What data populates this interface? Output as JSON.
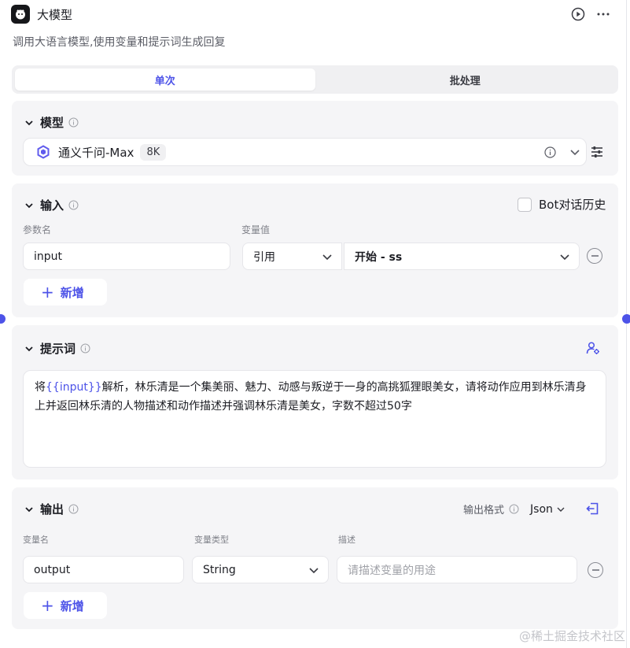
{
  "node": {
    "title": "大模型",
    "description": "调用大语言模型,使用变量和提示词生成回复"
  },
  "tabs": [
    {
      "label": "单次",
      "active": true
    },
    {
      "label": "批处理",
      "active": false
    }
  ],
  "model_section": {
    "title": "模型",
    "model_name": "通义千问-Max",
    "context_badge": "8K"
  },
  "input_section": {
    "title": "输入",
    "bot_history_label": "Bot对话历史",
    "bot_history_checked": false,
    "col_param_name": "参数名",
    "col_var_value": "变量值",
    "row": {
      "name": "input",
      "type": "引用",
      "ref": "开始 - ss"
    },
    "add_label": "新增"
  },
  "prompt_section": {
    "title": "提示词",
    "text_before": "将",
    "variable": "{{input}}",
    "text_after": "解析，林乐清是一个集美丽、魅力、动感与叛逆于一身的高挑狐狸眼美女，请将动作应用到林乐清身上并返回林乐清的人物描述和动作描述并强调林乐清是美女，字数不超过50字"
  },
  "output_section": {
    "title": "输出",
    "format_label": "输出格式",
    "format_value": "Json",
    "col_var_name": "变量名",
    "col_var_type": "变量类型",
    "col_desc": "描述",
    "row": {
      "name": "output",
      "type": "String",
      "desc_placeholder": "请描述变量的用途"
    },
    "add_label": "新增"
  },
  "watermark": "@稀土掘金技术社区",
  "colors": {
    "accent": "#4d53e8",
    "section_bg": "#f5f5f7"
  }
}
